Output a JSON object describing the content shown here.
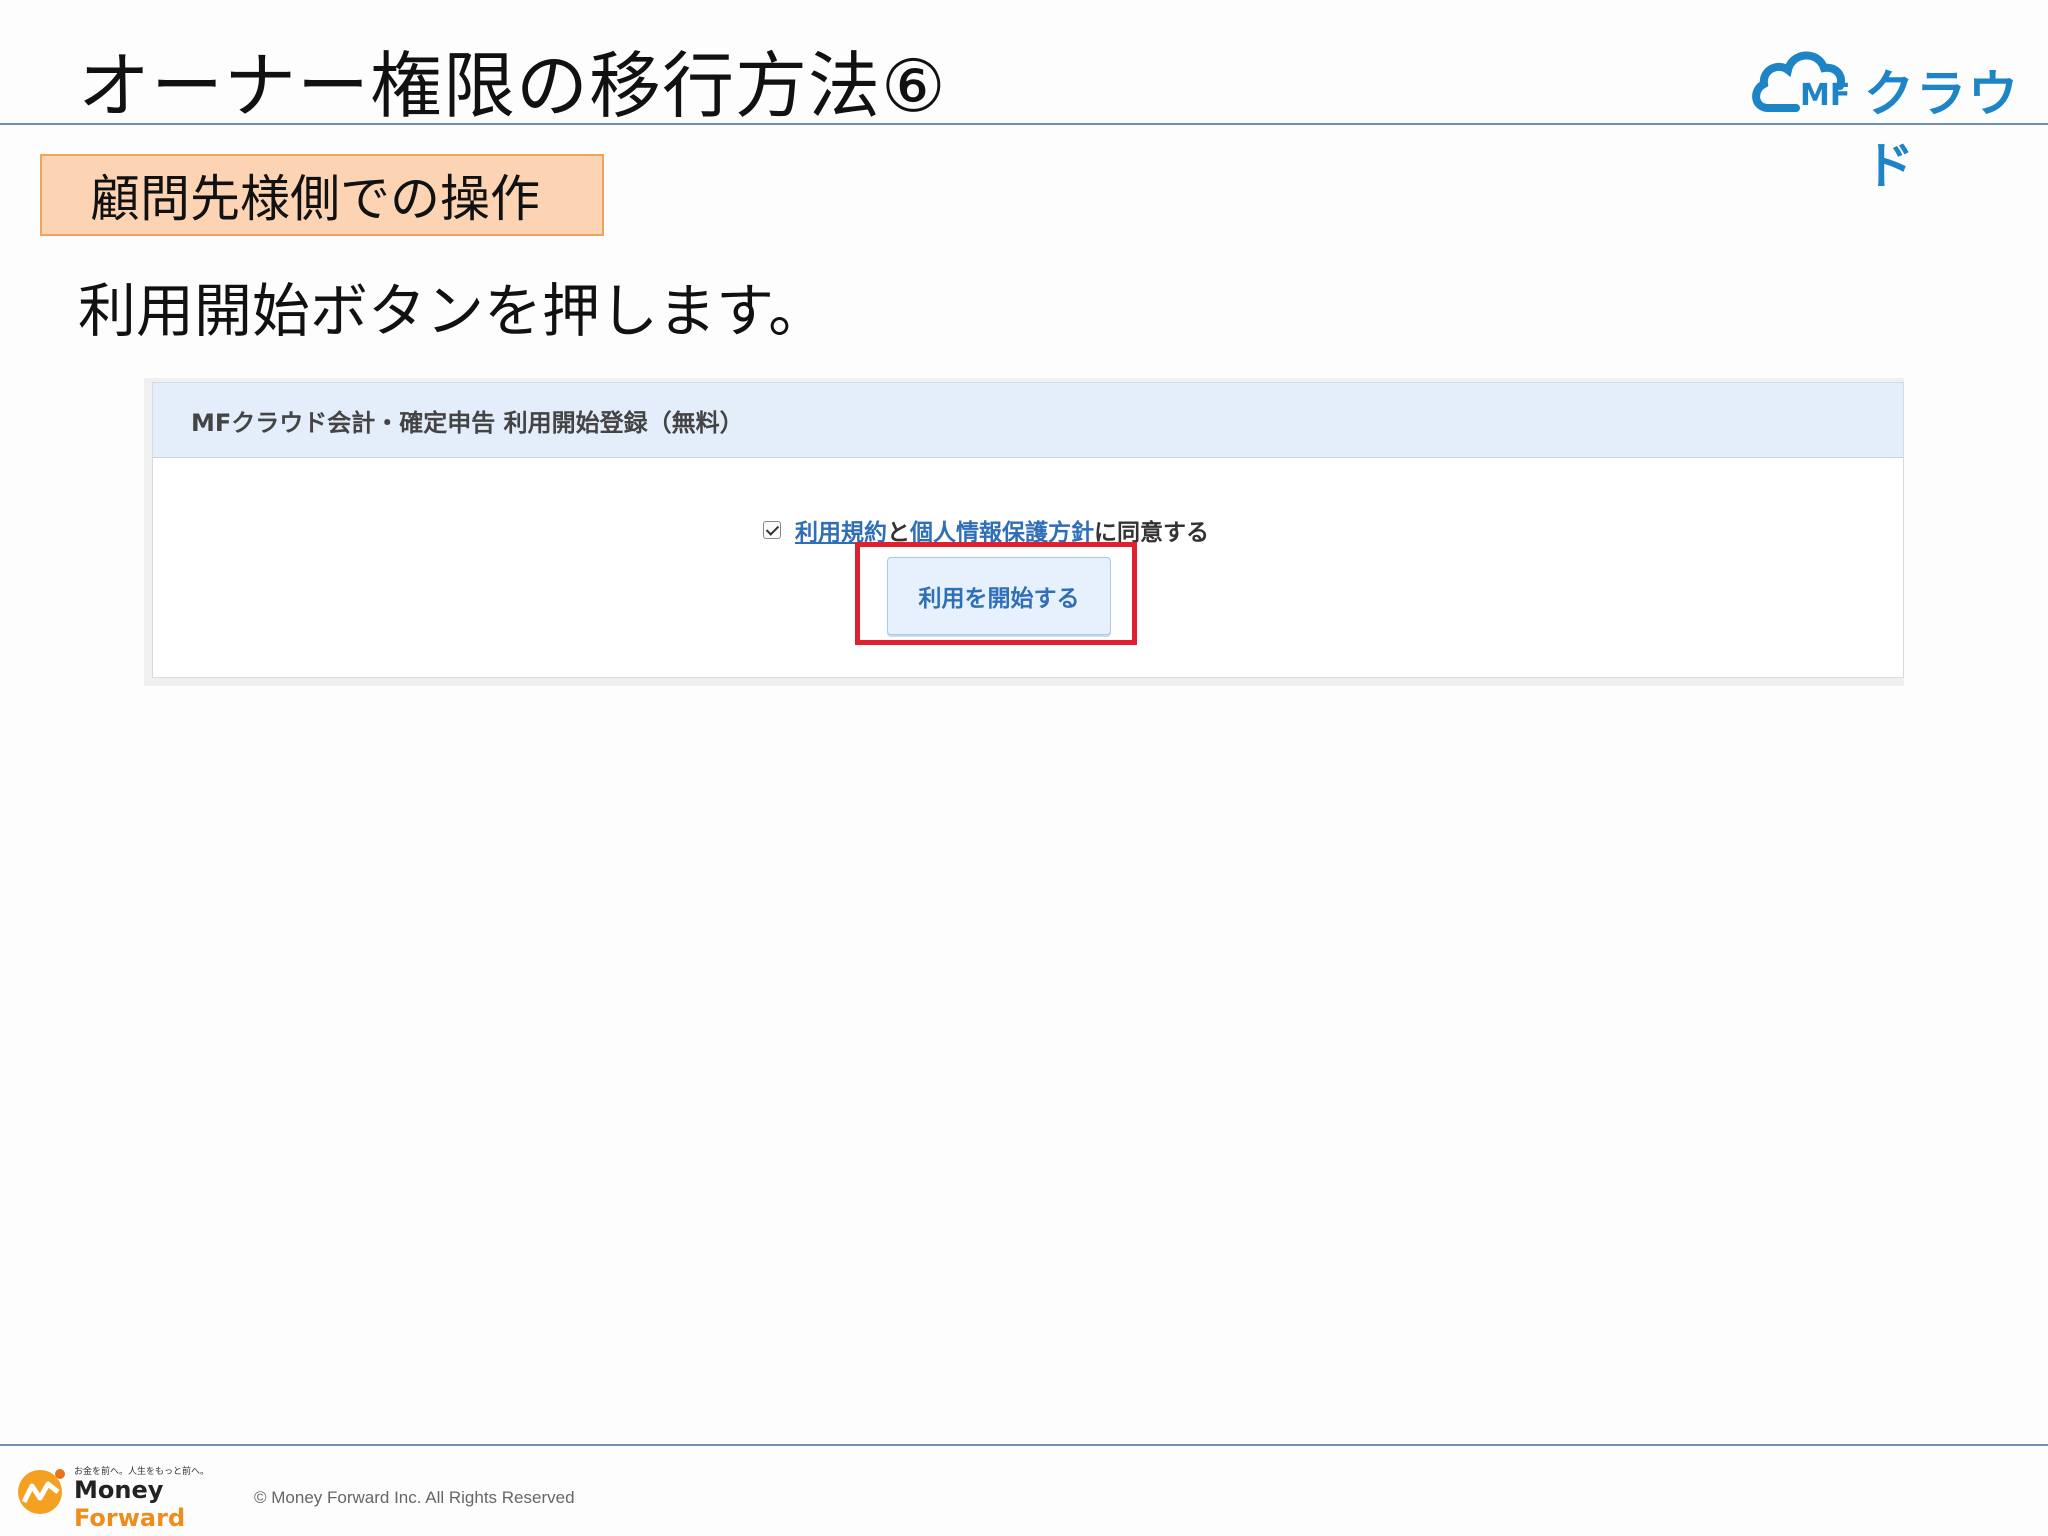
{
  "slide": {
    "title": "オーナー権限の移行方法⑥",
    "section_label": "顧問先様側での操作",
    "instruction": "利用開始ボタンを押します。"
  },
  "brand": {
    "mf": "MF",
    "name": "クラウド",
    "color": "#1d84c6"
  },
  "panel": {
    "header": "MFクラウド会計・確定申告 利用開始登録（無料）",
    "agreement": {
      "checked": true,
      "terms_link": "利用規約",
      "connector": "と",
      "privacy_link": "個人情報保護方針",
      "suffix": "に同意する"
    },
    "start_button": "利用を開始する",
    "highlight_color": "#e0202e"
  },
  "footer": {
    "tagline": "お金を前へ。人生をもっと前へ。",
    "logo_money": "Money",
    "logo_forward": "Forward",
    "copyright": "© Money Forward Inc. All Rights Reserved"
  }
}
